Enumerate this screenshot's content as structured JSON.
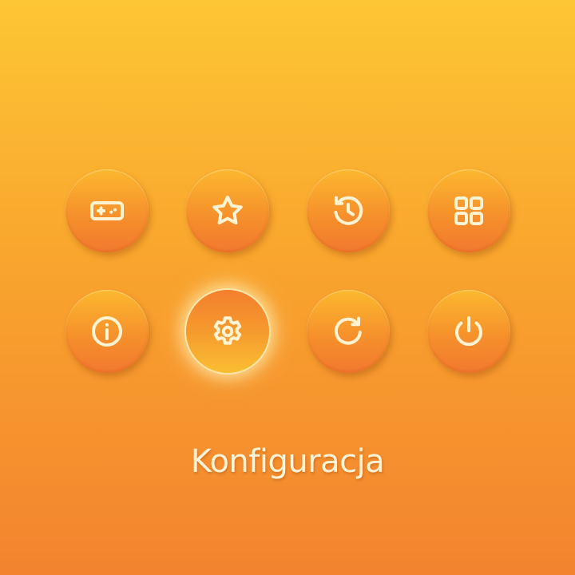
{
  "menu": {
    "buttons": [
      {
        "id": "games",
        "icon": "gamepad-icon",
        "selected": false
      },
      {
        "id": "favorites",
        "icon": "star-icon",
        "selected": false
      },
      {
        "id": "history",
        "icon": "history-icon",
        "selected": false
      },
      {
        "id": "apps",
        "icon": "grid-icon",
        "selected": false
      },
      {
        "id": "info",
        "icon": "info-icon",
        "selected": false
      },
      {
        "id": "settings",
        "icon": "gear-icon",
        "selected": true
      },
      {
        "id": "refresh",
        "icon": "refresh-icon",
        "selected": false
      },
      {
        "id": "power",
        "icon": "power-icon",
        "selected": false
      }
    ],
    "selected_label": "Konfiguracja"
  },
  "colors": {
    "background_top": "#fdc634",
    "background_bottom": "#f3832f",
    "icon_stroke": "#fff3d2",
    "label": "#fff3d6"
  }
}
